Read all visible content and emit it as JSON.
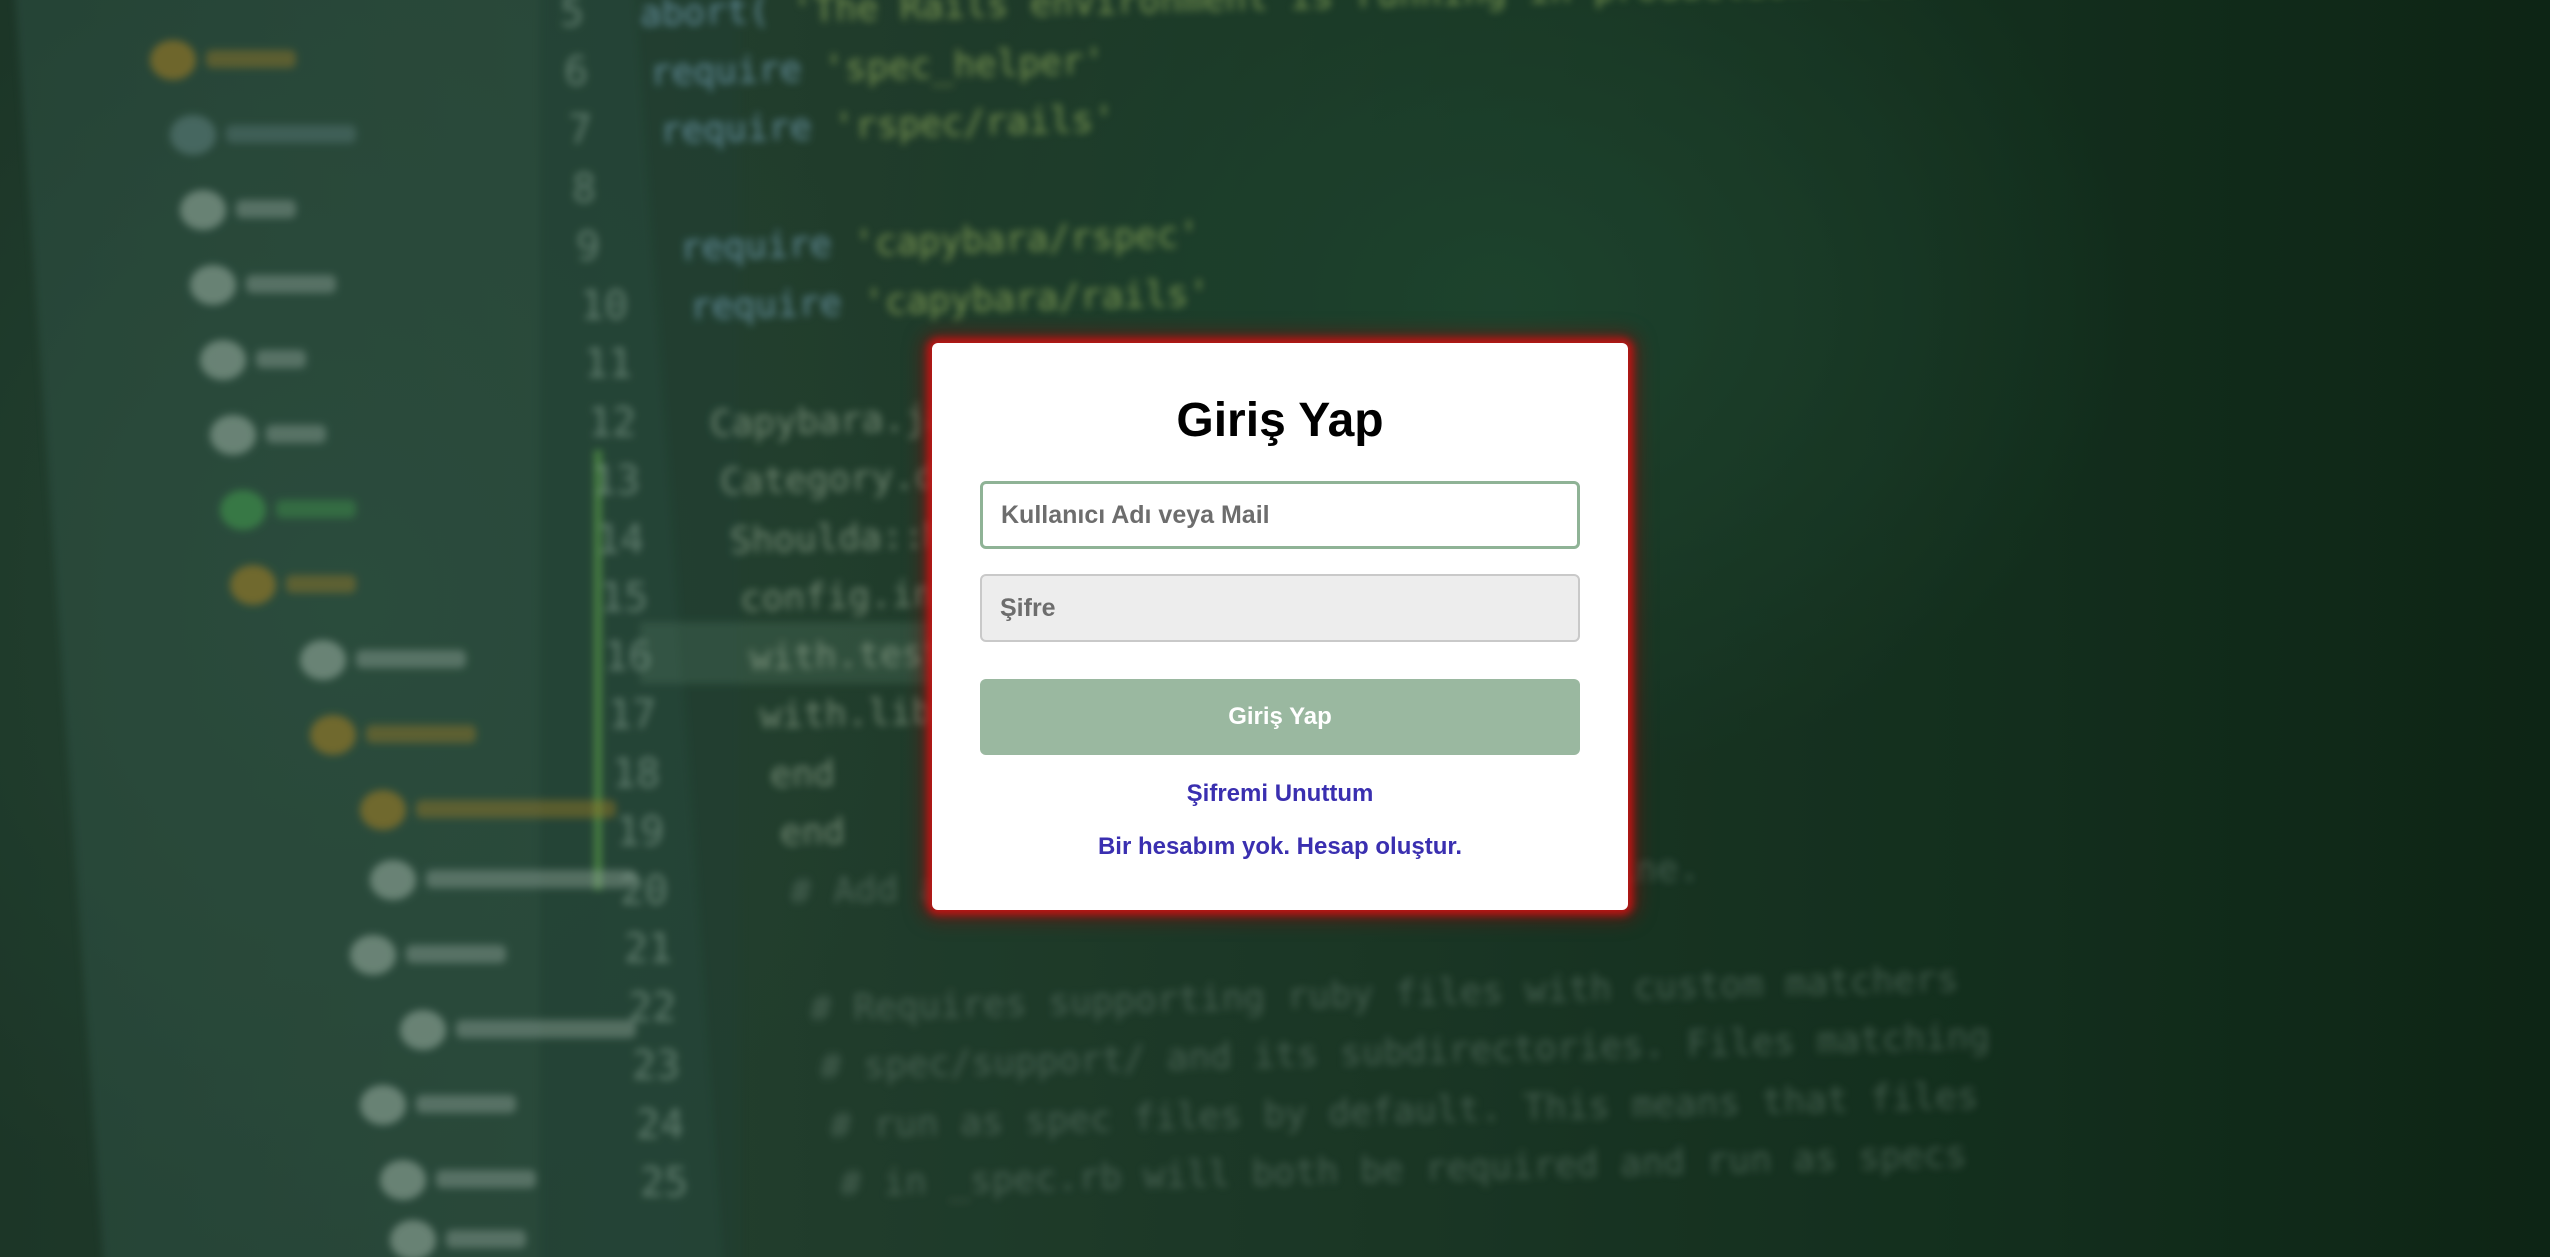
{
  "login": {
    "title": "Giriş Yap",
    "username_placeholder": "Kullanıcı Adı veya Mail",
    "password_placeholder": "Şifre",
    "submit_label": "Giriş Yap",
    "forgot_password_label": "Şifremi Unuttum",
    "signup_label": "Bir hesabım yok. Hesap oluştur."
  },
  "background_code": {
    "line_numbers": [
      "5",
      "6",
      "7",
      "8",
      "9",
      "10",
      "11",
      "12",
      "13",
      "14",
      "15",
      "16",
      "17",
      "18",
      "19",
      "20",
      "21",
      "22",
      "23",
      "24",
      "25"
    ],
    "lines": [
      {
        "kw": "abort(",
        "str": "'The Rails environment is running in production mode!'",
        "plain": ""
      },
      {
        "kw": "require",
        "str": "'spec_helper'",
        "plain": ""
      },
      {
        "kw": "require",
        "str": "'rspec/rails'",
        "plain": ""
      },
      {
        "kw": "",
        "str": "",
        "plain": ""
      },
      {
        "kw": "require",
        "str": "'capybara/rspec'",
        "plain": ""
      },
      {
        "kw": "require",
        "str": "'capybara/rails'",
        "plain": ""
      },
      {
        "kw": "",
        "str": "",
        "plain": ""
      },
      {
        "kw": "",
        "str": "",
        "plain": "Capybara.javascript_driver"
      },
      {
        "kw": "",
        "str": "",
        "plain": "Category.delete_all"
      },
      {
        "kw": "",
        "str": "",
        "plain": "Shoulda::Matchers"
      },
      {
        "kw": "",
        "str": "",
        "plain": "  config.integrate"
      },
      {
        "kw": "",
        "str": "",
        "plain": "    with.test_framework"
      },
      {
        "kw": "",
        "str": "",
        "plain": "    with.library"
      },
      {
        "kw": "",
        "str": "",
        "plain": "  end"
      },
      {
        "kw": "",
        "str": "",
        "plain": "end"
      },
      {
        "kw": "",
        "str": "",
        "cmt": "# Add additional requires below this line."
      },
      {
        "kw": "",
        "str": "",
        "plain": ""
      },
      {
        "kw": "",
        "str": "",
        "cmt": "# Requires supporting ruby files with custom matchers"
      },
      {
        "kw": "",
        "str": "",
        "cmt": "# spec/support/ and its subdirectories. Files matching"
      },
      {
        "kw": "",
        "str": "",
        "cmt": "# run as spec files by default. This means that files"
      },
      {
        "kw": "",
        "str": "",
        "cmt": "# in _spec.rb will both be required and run as specs"
      }
    ]
  },
  "colors": {
    "accent_green": "#9ab8a0",
    "input_focus_border": "#8fb396",
    "link_color": "#3a2fb0",
    "card_glow": "#c81414"
  }
}
